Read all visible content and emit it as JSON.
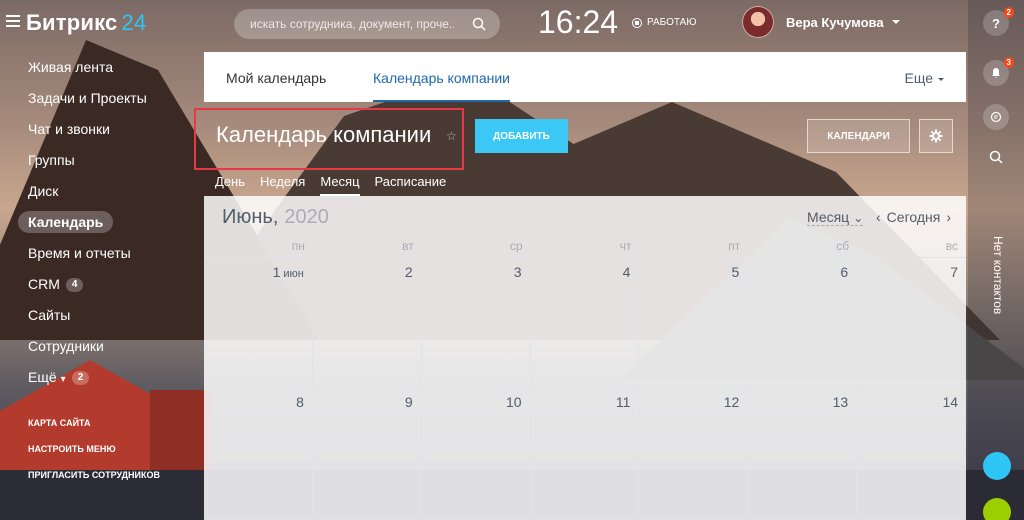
{
  "header": {
    "logo_text": "Битрикс",
    "logo_num": "24",
    "search_placeholder": "искать сотрудника, документ, проче...",
    "clock": "16:24",
    "work_status": "РАБОТАЮ",
    "user_name": "Вера Кучумова"
  },
  "sidebar": {
    "items": [
      {
        "label": "Живая лента"
      },
      {
        "label": "Задачи и Проекты"
      },
      {
        "label": "Чат и звонки"
      },
      {
        "label": "Группы"
      },
      {
        "label": "Диск"
      },
      {
        "label": "Календарь"
      },
      {
        "label": "Время и отчеты"
      },
      {
        "label": "CRM",
        "badge": "4"
      },
      {
        "label": "Сайты"
      },
      {
        "label": "Сотрудники"
      },
      {
        "label": "Ещё",
        "badge": "2"
      }
    ],
    "sub_items": [
      {
        "label": "КАРТА САЙТА"
      },
      {
        "label": "НАСТРОИТЬ МЕНЮ"
      },
      {
        "label": "ПРИГЛАСИТЬ СОТРУДНИКОВ"
      }
    ]
  },
  "rightbar": {
    "help_badge": "2",
    "notif_badge": "3",
    "contacts_text": "Нет контактов"
  },
  "tabs": {
    "my_calendar": "Мой календарь",
    "company_calendar": "Календарь компании",
    "more": "Еще"
  },
  "title": {
    "page_title": "Календарь компании",
    "add_button": "ДОБАВИТЬ",
    "calendars_button": "КАЛЕНДАРИ"
  },
  "view_tabs": [
    "День",
    "Неделя",
    "Месяц",
    "Расписание"
  ],
  "calendar": {
    "month": "Июнь,",
    "year": "2020",
    "view_select": "Месяц",
    "today": "Сегодня",
    "weekdays": [
      "пн",
      "вт",
      "ср",
      "чт",
      "пт",
      "сб",
      "вс"
    ],
    "weeks": [
      [
        "1",
        "2",
        "3",
        "4",
        "5",
        "6",
        "7"
      ],
      [
        "8",
        "9",
        "10",
        "11",
        "12",
        "13",
        "14"
      ]
    ],
    "first_day_month": "июн"
  }
}
